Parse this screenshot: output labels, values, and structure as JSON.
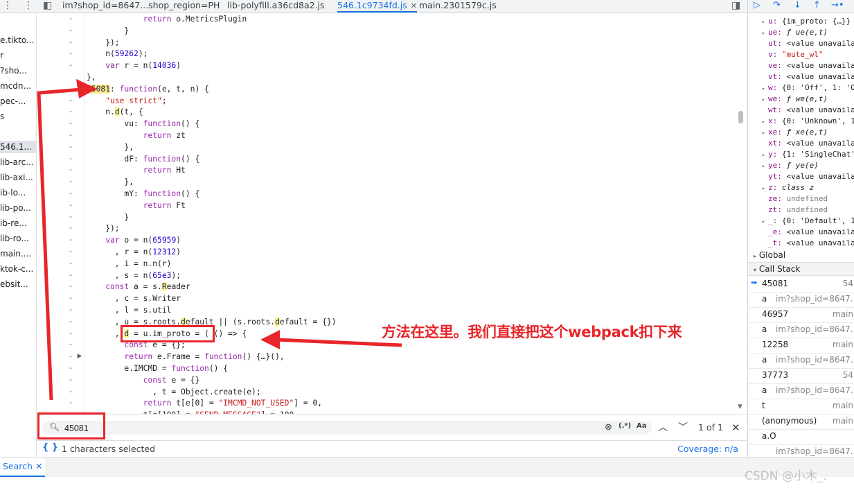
{
  "tabs": [
    {
      "label": "im?shop_id=8647...shop_region=PH",
      "active": false
    },
    {
      "label": "lib-polyfill.a36cd8a2.js",
      "active": false
    },
    {
      "label": "546.1c9734fd.js",
      "active": true
    },
    {
      "label": "main.2301579c.js",
      "active": false
    }
  ],
  "navigator": [
    "e.tikto...",
    "r",
    "?sho...",
    "mcdn...",
    "pec-...",
    "s",
    "",
    "546.1...",
    "lib-arc...",
    "lib-axi...",
    "ib-lo...",
    "lib-po...",
    "ib-re...",
    "lib-ro...",
    "main....",
    "ktok-c...",
    "ebsit..."
  ],
  "code": [
    "            return o.MetricsPlugin",
    "        }",
    "    });",
    "    n(59262);",
    "    var r = n(14036)",
    "},",
    "45081: function(e, t, n) {",
    "    \"use strict\";",
    "    n.d(t, {",
    "        vu: function() {",
    "            return zt",
    "        },",
    "        dF: function() {",
    "            return Ht",
    "        },",
    "        mY: function() {",
    "            return Ft",
    "        }",
    "    });",
    "    var o = n(65959)",
    "      , r = n(12312)",
    "      , i = n.n(r)",
    "      , s = n(65e3);",
    "    const a = s.Reader",
    "      , c = s.Writer",
    "      , l = s.util",
    "      , u = s.roots.default || (s.roots.default = {})",
    "      , d = u.im_proto = ( () => {",
    "        const e = {};",
    "        return e.Frame = function() {…}(),",
    "        e.IMCMD = function() {",
    "            const e = {}",
    "              , t = Object.create(e);",
    "            return t[e[0] = \"IMCMD_NOT_USED\"] = 0,",
    "            t[e[100] = \"SEND_MESSAGE\"] = 100,"
  ],
  "search": {
    "value": "45081",
    "match_count": "1 of 1",
    "regex_label": "(.*)",
    "case_label": "Aa"
  },
  "status": {
    "selection": "1 characters selected",
    "coverage": "Coverage: n/a"
  },
  "drawer": {
    "tab_label": "Search"
  },
  "scope": [
    {
      "tri": "▸",
      "key": "u:",
      "rest": " {im_proto: {…}}",
      "cls": "val"
    },
    {
      "tri": "▸",
      "key": "ue:",
      "rest": " ƒ ue(e,t)",
      "cls": "fn"
    },
    {
      "tri": "",
      "key": "ut:",
      "rest": " <value unavaila",
      "cls": "val"
    },
    {
      "tri": "",
      "key": "v:",
      "rest": " \"mute_wl\"",
      "cls": "str"
    },
    {
      "tri": "",
      "key": "ve:",
      "rest": " <value unavaila",
      "cls": "val"
    },
    {
      "tri": "",
      "key": "vt:",
      "rest": " <value unavaila",
      "cls": "val"
    },
    {
      "tri": "▸",
      "key": "w:",
      "rest": " {0: 'Off', 1: 'O",
      "cls": "val"
    },
    {
      "tri": "▸",
      "key": "we:",
      "rest": " ƒ we(e,t)",
      "cls": "fn"
    },
    {
      "tri": "",
      "key": "wt:",
      "rest": " <value unavaila",
      "cls": "val"
    },
    {
      "tri": "▸",
      "key": "x:",
      "rest": " {0: 'Unknown', 1",
      "cls": "val"
    },
    {
      "tri": "▸",
      "key": "xe:",
      "rest": " ƒ xe(e,t)",
      "cls": "fn"
    },
    {
      "tri": "",
      "key": "xt:",
      "rest": " <value unavaila",
      "cls": "val"
    },
    {
      "tri": "▸",
      "key": "y:",
      "rest": " {1: 'SingleChat'",
      "cls": "val"
    },
    {
      "tri": "▸",
      "key": "ye:",
      "rest": " ƒ ye(e)",
      "cls": "fn"
    },
    {
      "tri": "",
      "key": "yt:",
      "rest": " <value unavaila",
      "cls": "val"
    },
    {
      "tri": "▸",
      "key": "z:",
      "rest": " class z",
      "cls": "fn"
    },
    {
      "tri": "",
      "key": "ze:",
      "rest": " undefined",
      "cls": "muted"
    },
    {
      "tri": "",
      "key": "zt:",
      "rest": " undefined",
      "cls": "muted"
    },
    {
      "tri": "▸",
      "key": "_:",
      "rest": " {0: 'Default', 1",
      "cls": "val"
    },
    {
      "tri": "",
      "key": "_e:",
      "rest": " <value unavaila",
      "cls": "val"
    },
    {
      "tri": "",
      "key": "_t:",
      "rest": " <value unavaila",
      "cls": "val"
    }
  ],
  "global_label": "Global",
  "callstack_label": "Call Stack",
  "callstack": [
    {
      "fn": "45081",
      "loc": "54",
      "current": true
    },
    {
      "fn": "a",
      "loc": "im?shop_id=8647....",
      "current": false
    },
    {
      "fn": "46957",
      "loc": "main",
      "current": false
    },
    {
      "fn": "a",
      "loc": "im?shop_id=8647....",
      "current": false
    },
    {
      "fn": "12258",
      "loc": "main",
      "current": false
    },
    {
      "fn": "a",
      "loc": "im?shop_id=8647....",
      "current": false
    },
    {
      "fn": "37773",
      "loc": "54",
      "current": false
    },
    {
      "fn": "a",
      "loc": "im?shop_id=8647....",
      "current": false
    },
    {
      "fn": "t",
      "loc": "main",
      "current": false
    },
    {
      "fn": "(anonymous)",
      "loc": "main",
      "current": false
    },
    {
      "fn": "a.O",
      "loc": "",
      "current": false
    },
    {
      "fn": "",
      "loc": "im?shop_id=8647....",
      "current": false
    }
  ],
  "annotation": {
    "text": "方法在这里。我们直接把这个webpack扣下来"
  },
  "watermark": "CSDN @小木_."
}
